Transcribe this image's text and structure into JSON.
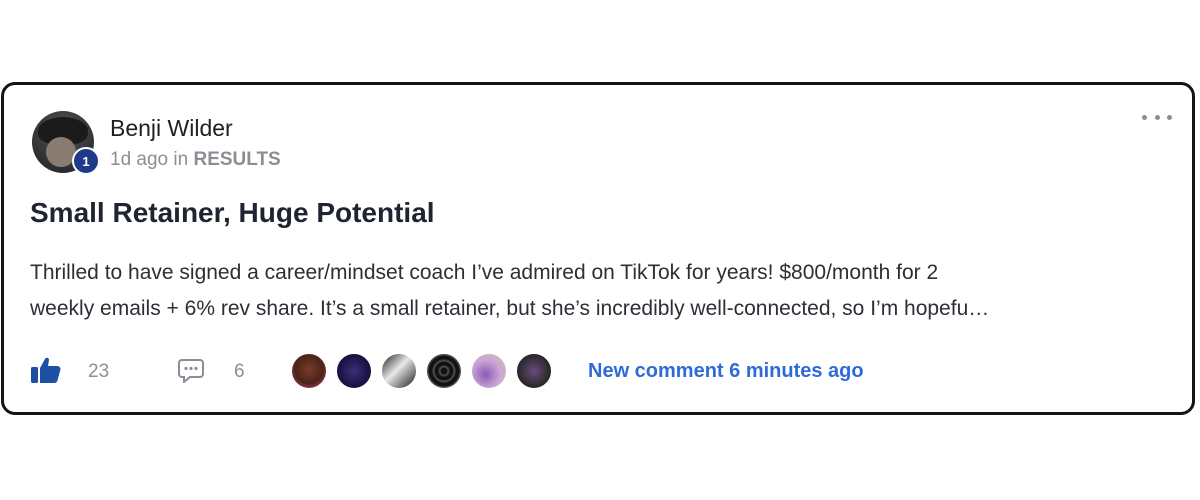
{
  "post": {
    "author": "Benji Wilder",
    "author_level": "1",
    "time_ago": "1d ago in",
    "category": "RESULTS",
    "title": "Small Retainer, Huge Potential",
    "body_line1": "Thrilled to have signed a career/mindset coach I’ve admired on TikTok for years! $800/month for 2",
    "body_line2": "weekly emails + 6% rev share. It’s a small retainer, but she’s incredibly well-connected, so I’m hopefu…"
  },
  "footer": {
    "like_count": "23",
    "comment_count": "6",
    "participants_count": 6,
    "new_comment_text": "New comment 6 minutes ago"
  },
  "icons": {
    "like": "thumbs-up-icon",
    "comment": "speech-bubble-icon",
    "more": "more-dots-icon"
  },
  "colors": {
    "accent_blue": "#2f6bd8",
    "badge_blue": "#1f3a8a",
    "like_blue": "#1f4fa3"
  }
}
